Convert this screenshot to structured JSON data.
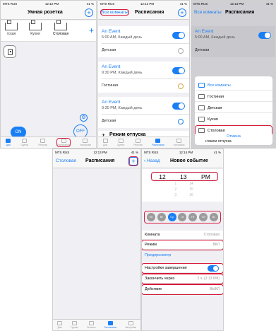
{
  "status": {
    "carrier": "MTS RUS",
    "time_a": "12:12 PM",
    "time_b": "12:13 PM",
    "time_c": "12:14 PM",
    "battery": "41 %"
  },
  "phone1": {
    "title": "Умная розетка",
    "rooms": [
      {
        "label": "тская"
      },
      {
        "label": "Кухня"
      },
      {
        "label": "Столовая"
      }
    ],
    "on_label": "ON",
    "off_label": "OFF"
  },
  "phone2": {
    "all_rooms_link": "Все комнаты",
    "title": "Расписания",
    "events": [
      {
        "title": "An Event",
        "time": "5:00 AM, Каждый день",
        "room": "Детская"
      },
      {
        "title": "An Event",
        "time": "9:30 PM, Каждый день",
        "room": "Гостиная"
      },
      {
        "title": "An Event",
        "time": "9:30 PM, Каждый день",
        "room": "Детская"
      }
    ],
    "vacation_label": "Режим отпуска"
  },
  "phone3": {
    "all_rooms_link": "Все комнаты",
    "title": "Расписания",
    "event_title": "An Event",
    "event_time": "5:00 AM, Каждый день",
    "event_room": "Детская",
    "sheet_items": [
      {
        "label": "Все комнаты"
      },
      {
        "label": "Гостиная"
      },
      {
        "label": "Детская"
      },
      {
        "label": "Кухня"
      },
      {
        "label": "Столовая"
      }
    ],
    "behind_label": "Режим отпуска",
    "cancel_label": "Отмена"
  },
  "phone4": {
    "back_room": "Столовая",
    "title": "Расписания"
  },
  "phone5": {
    "back_label": "Назад",
    "title": "Новое событие",
    "picker_selected": [
      "12",
      "13",
      "PM"
    ],
    "picker_below": [
      [
        "1",
        "14"
      ],
      [
        "2",
        "15"
      ],
      [
        "3",
        "16"
      ]
    ],
    "days": [
      "Пн",
      "Вт",
      "Ср",
      "Чт",
      "Пт",
      "Сб",
      "Вс"
    ],
    "room_label": "Комната",
    "room_value": "Столовая",
    "mode_label": "Режим",
    "mode_value": "ВКЛ",
    "preview_label": "Предпросмотр",
    "end_settings_label": "Настройки завершения",
    "end_after_label": "Закончить через",
    "end_after_value": "2 ч. (2:13 PM)",
    "action_label": "Действие",
    "action_value": "ВЫКЛ"
  },
  "tabs": [
    "Дом",
    "Группы",
    "Регионы",
    "Расписания",
    "Настройки"
  ],
  "colors": {
    "accent": "#1a7ef5",
    "highlight": "#d91b3e"
  }
}
